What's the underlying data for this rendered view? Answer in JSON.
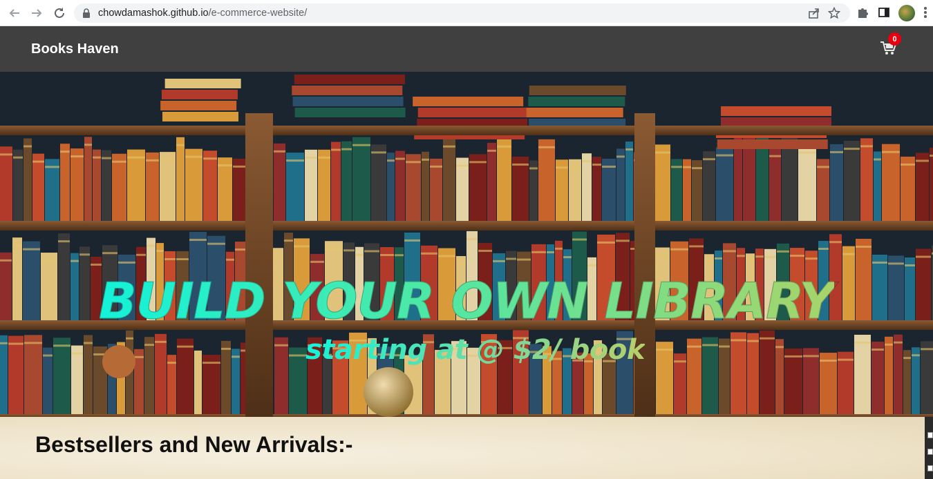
{
  "browser": {
    "url_host": "chowdamashok.github.io",
    "url_path": "/e-commerce-website/",
    "icons": [
      "back-arrow-icon",
      "forward-arrow-icon",
      "reload-icon",
      "lock-icon",
      "share-icon",
      "star-icon",
      "puzzle-icon",
      "side-panel-icon",
      "profile-avatar",
      "kebab-menu-icon"
    ]
  },
  "header": {
    "brand": "Books Haven",
    "cart_count": "0",
    "cart_icon": "cart-icon",
    "background": "#404040",
    "badge_color": "#e8000e"
  },
  "hero": {
    "title": "BUILD YOUR OWN LIBRARY",
    "subtitle": "starting at @ $2/ book",
    "gradient_start": "#14f2d9",
    "gradient_end": "#a8d46a"
  },
  "section": {
    "heading": "Bestsellers and New Arrivals:-"
  }
}
